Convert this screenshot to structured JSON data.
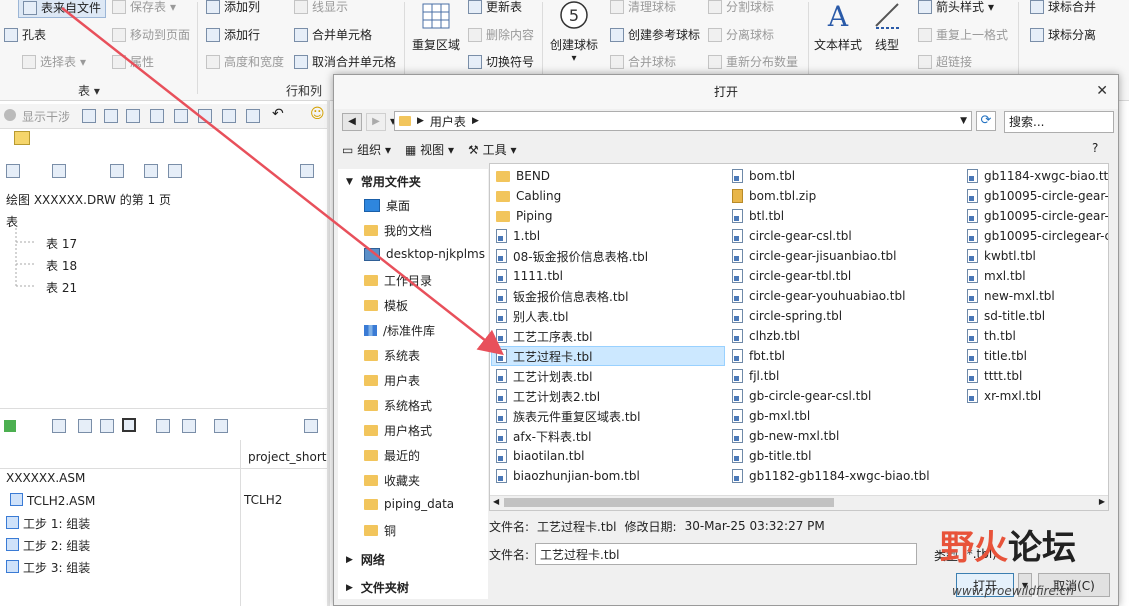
{
  "ribbon": {
    "groups": {
      "table": "表",
      "rows_cols": "行和列"
    },
    "table_from_file": "表来自文件",
    "save_table": "保存表",
    "hole_table": "孔表",
    "select_table": "选择表",
    "move_to_page": "移动到页面",
    "attributes": "属性",
    "add_column": "添加列",
    "add_row": "添加行",
    "height_width": "高度和宽度",
    "line_display": "线显示",
    "merge_cells": "合并单元格",
    "unmerge_cells": "取消合并单元格",
    "repeat_region": "重复区域",
    "update_table": "更新表",
    "delete_content": "删除内容",
    "toggle_symbol": "切换符号",
    "create_balloon": "创建球标",
    "clear_balloon": "清理球标",
    "create_ref_balloon": "创建参考球标",
    "merge_balloon": "合并球标",
    "split_balloon": "分割球标",
    "split_balloon2": "分离球标",
    "redistribute_qty": "重新分布数量",
    "text_style": "文本样式",
    "line_type": "线型",
    "arrow_style": "箭头样式",
    "repeat_last_format": "重复上一格式",
    "hyperlink": "超链接",
    "balloon_merge": "球标合并",
    "balloon_separate": "球标分离",
    "balloon_number": "5"
  },
  "quickbar": {
    "show_steps": "显示干涉"
  },
  "drawing_tree": {
    "title": "绘图 XXXXXX.DRW 的第 1 页",
    "section": "表",
    "items": [
      "表 17",
      "表 18",
      "表 21"
    ]
  },
  "model_tree": {
    "column_header": "project_short",
    "rows": [
      {
        "name": "XXXXXX.ASM",
        "value": ""
      },
      {
        "name": "TCLH2.ASM",
        "value": "TCLH2"
      },
      {
        "name": "工步 1: 组装",
        "value": ""
      },
      {
        "name": "工步 2: 组装",
        "value": ""
      },
      {
        "name": "工步 3: 组装",
        "value": ""
      }
    ]
  },
  "dialog": {
    "title": "打开",
    "breadcrumb": "用户表",
    "search_placeholder": "搜索...",
    "toolbar": {
      "organize": "组织",
      "views": "视图",
      "tools": "工具",
      "help": "?"
    },
    "sidebar": {
      "common_header": "常用文件夹",
      "items": [
        "桌面",
        "我的文档",
        "desktop-njkplms",
        "工作目录",
        "模板",
        "/标准件库",
        "系统表",
        "用户表",
        "系统格式",
        "用户格式",
        "最近的",
        "收藏夹",
        "piping_data",
        "铜"
      ],
      "network": "网络",
      "folder_tree": "文件夹树"
    },
    "files": {
      "col1": [
        {
          "name": "BEND",
          "kind": "folder"
        },
        {
          "name": "Cabling",
          "kind": "folder"
        },
        {
          "name": "Piping",
          "kind": "folder"
        },
        {
          "name": "1.tbl",
          "kind": "tbl"
        },
        {
          "name": "08-钣金报价信息表格.tbl",
          "kind": "tbl"
        },
        {
          "name": "1111.tbl",
          "kind": "tbl"
        },
        {
          "name": "钣金报价信息表格.tbl",
          "kind": "tbl"
        },
        {
          "name": "别人表.tbl",
          "kind": "tbl"
        },
        {
          "name": "工艺工序表.tbl",
          "kind": "tbl"
        },
        {
          "name": "工艺过程卡.tbl",
          "kind": "tbl",
          "selected": true
        },
        {
          "name": "工艺计划表.tbl",
          "kind": "tbl"
        },
        {
          "name": "工艺计划表2.tbl",
          "kind": "tbl"
        },
        {
          "name": "族表元件重复区域表.tbl",
          "kind": "tbl"
        },
        {
          "name": "afx-下料表.tbl",
          "kind": "tbl"
        },
        {
          "name": "biaotilan.tbl",
          "kind": "tbl"
        },
        {
          "name": "biaozhunjian-bom.tbl",
          "kind": "tbl"
        }
      ],
      "col2": [
        {
          "name": "bom.tbl",
          "kind": "tbl"
        },
        {
          "name": "bom.tbl.zip",
          "kind": "zip"
        },
        {
          "name": "btl.tbl",
          "kind": "tbl"
        },
        {
          "name": "circle-gear-csl.tbl",
          "kind": "tbl"
        },
        {
          "name": "circle-gear-jisuanbiao.tbl",
          "kind": "tbl"
        },
        {
          "name": "circle-gear-tbl.tbl",
          "kind": "tbl"
        },
        {
          "name": "circle-gear-youhuabiao.tbl",
          "kind": "tbl"
        },
        {
          "name": "circle-spring.tbl",
          "kind": "tbl"
        },
        {
          "name": "clhzb.tbl",
          "kind": "tbl"
        },
        {
          "name": "fbt.tbl",
          "kind": "tbl"
        },
        {
          "name": "fjl.tbl",
          "kind": "tbl"
        },
        {
          "name": "gb-circle-gear-csl.tbl",
          "kind": "tbl"
        },
        {
          "name": "gb-mxl.tbl",
          "kind": "tbl"
        },
        {
          "name": "gb-new-mxl.tbl",
          "kind": "tbl"
        },
        {
          "name": "gb-title.tbl",
          "kind": "tbl"
        },
        {
          "name": "gb1182-gb1184-xwgc-biao.tbl",
          "kind": "tbl"
        }
      ],
      "col3": [
        {
          "name": "gb1184-xwgc-biao.tt",
          "kind": "tbl"
        },
        {
          "name": "gb10095-circle-gear-",
          "kind": "tbl"
        },
        {
          "name": "gb10095-circle-gear-",
          "kind": "tbl"
        },
        {
          "name": "gb10095-circlegear-c",
          "kind": "tbl"
        },
        {
          "name": "kwbtl.tbl",
          "kind": "tbl"
        },
        {
          "name": "mxl.tbl",
          "kind": "tbl"
        },
        {
          "name": "new-mxl.tbl",
          "kind": "tbl"
        },
        {
          "name": "sd-title.tbl",
          "kind": "tbl"
        },
        {
          "name": "th.tbl",
          "kind": "tbl"
        },
        {
          "name": "title.tbl",
          "kind": "tbl"
        },
        {
          "name": "tttt.tbl",
          "kind": "tbl"
        },
        {
          "name": "xr-mxl.tbl",
          "kind": "tbl"
        }
      ]
    },
    "info": {
      "label": "文件名:",
      "name": "工艺过程卡.tbl",
      "modified_label": "修改日期:",
      "modified": "30-Mar-25 03:32:27 PM"
    },
    "filename_label": "文件名:",
    "filename_value": "工艺过程卡.tbl",
    "type_label": "类型",
    "type_value": "(*.tbl)",
    "open_button": "打开",
    "cancel_button": "取消(C)"
  },
  "watermark": {
    "text": "野火论坛",
    "url": "www.proewildfire.cn"
  },
  "colors": {
    "selection": "#cce8ff",
    "arrow": "#e8505b",
    "folder": "#f2c55c",
    "watermark_fire": "#e8533a"
  }
}
